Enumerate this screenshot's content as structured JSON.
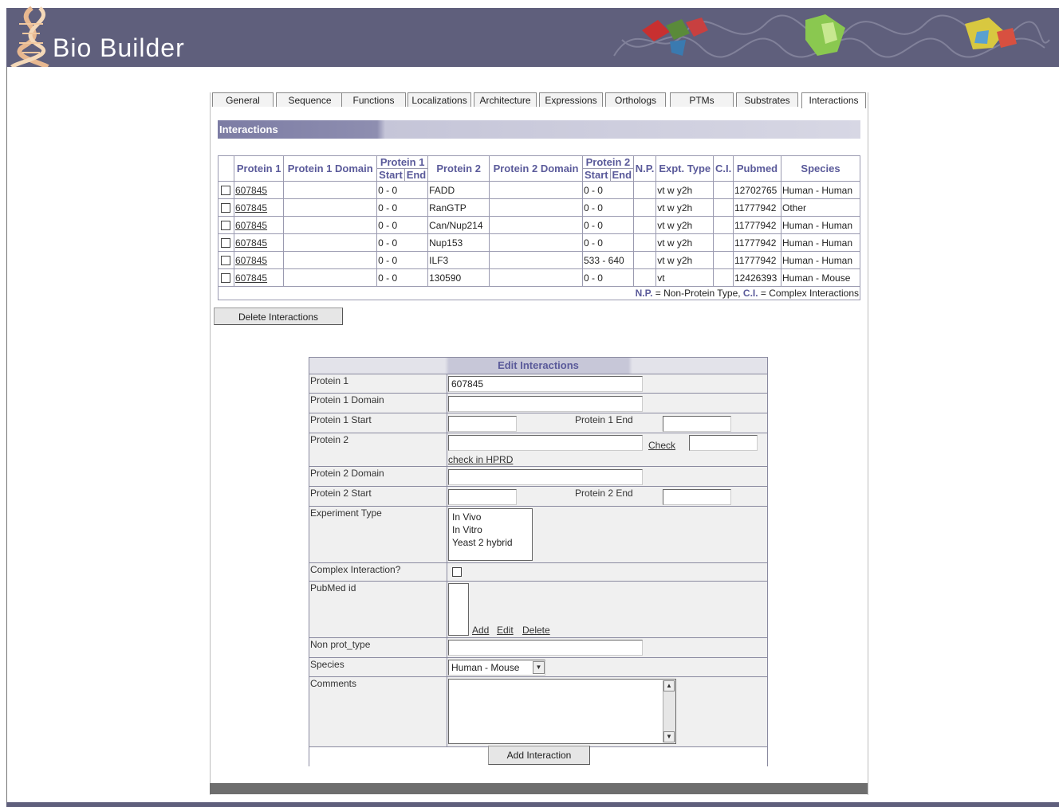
{
  "app": {
    "title": "Bio Builder"
  },
  "tabs": [
    "General",
    "Sequence",
    "Functions",
    "Localizations",
    "Architecture",
    "Expressions",
    "Orthologs",
    "PTMs",
    "Substrates",
    "Interactions"
  ],
  "active_tab": "Interactions",
  "section_title": "Interactions",
  "table": {
    "headers": {
      "protein1": "Protein 1",
      "protein1_domain": "Protein 1 Domain",
      "protein1_range": "Protein 1",
      "protein2": "Protein 2",
      "protein2_domain": "Protein 2 Domain",
      "protein2_range": "Protein 2",
      "np": "N.P.",
      "expt_type": "Expt. Type",
      "ci": "C.I.",
      "pubmed": "Pubmed",
      "species": "Species",
      "start": "Start",
      "end": "End"
    },
    "rows": [
      {
        "protein1": "607845",
        "p1_range": "0 - 0",
        "protein2": "FADD",
        "p2_range": "0 - 0",
        "expt": "vt w y2h",
        "pubmed": "12702765",
        "species": "Human - Human"
      },
      {
        "protein1": "607845",
        "p1_range": "0 - 0",
        "protein2": "RanGTP",
        "p2_range": "0 - 0",
        "expt": "vt w y2h",
        "pubmed": "11777942",
        "species": "Other"
      },
      {
        "protein1": "607845",
        "p1_range": "0 - 0",
        "protein2": "Can/Nup214",
        "p2_range": "0 - 0",
        "expt": "vt w y2h",
        "pubmed": "11777942",
        "species": "Human - Human"
      },
      {
        "protein1": "607845",
        "p1_range": "0 - 0",
        "protein2": "Nup153",
        "p2_range": "0 - 0",
        "expt": "vt w y2h",
        "pubmed": "11777942",
        "species": "Human - Human"
      },
      {
        "protein1": "607845",
        "p1_range": "0 - 0",
        "protein2": "ILF3",
        "p2_range": "533 - 640",
        "expt": "vt w y2h",
        "pubmed": "11777942",
        "species": "Human - Human"
      },
      {
        "protein1": "607845",
        "p1_range": "0 - 0",
        "protein2": "130590",
        "p2_range": "0 - 0",
        "expt": "vt",
        "pubmed": "12426393",
        "species": "Human - Mouse"
      }
    ],
    "legend": {
      "np_abbr": "N.P.",
      "np_text": " = Non-Protein Type, ",
      "ci_abbr": "C.I.",
      "ci_text": " = Complex Interactions"
    }
  },
  "delete_button": "Delete Interactions",
  "edit": {
    "title": "Edit Interactions",
    "labels": {
      "protein1": "Protein 1",
      "protein1_domain": "Protein 1 Domain",
      "protein1_start": "Protein 1 Start",
      "protein1_end": "Protein 1 End",
      "protein2": "Protein 2",
      "check": "Check",
      "check_hprd": "check in HPRD",
      "protein2_domain": "Protein 2 Domain",
      "protein2_start": "Protein 2 Start",
      "protein2_end": "Protein 2 End",
      "experiment_type": "Experiment Type",
      "complex": "Complex Interaction?",
      "pubmed": "PubMed id",
      "add": "Add",
      "edit": "Edit",
      "delete": "Delete",
      "non_prot": "Non prot_type",
      "species": "Species",
      "comments": "Comments"
    },
    "values": {
      "protein1": "607845",
      "species": "Human - Mouse"
    },
    "experiment_options": [
      "In Vivo",
      "In Vitro",
      "Yeast 2 hybrid"
    ],
    "submit": "Add Interaction"
  },
  "icons": {
    "dropdown": "chevron-down-icon",
    "scroll_up": "arrow-up-icon",
    "scroll_down": "arrow-down-icon",
    "logo": "dna-helix-icon"
  },
  "colors": {
    "banner": "#5f5f7c",
    "header_text": "#5a5a9a",
    "section_head": "#7c7ca4"
  }
}
